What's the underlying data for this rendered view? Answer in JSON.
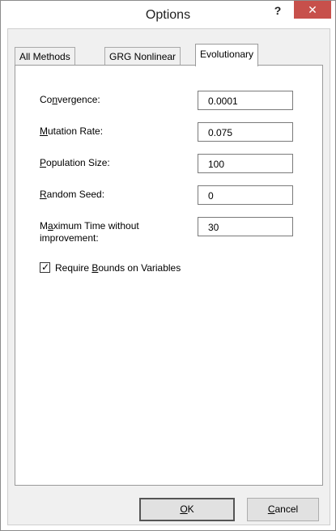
{
  "window": {
    "title": "Options",
    "help_label": "?",
    "close_label": "✕"
  },
  "tabs": [
    {
      "label": "All Methods",
      "active": false
    },
    {
      "label": "GRG Nonlinear",
      "active": false
    },
    {
      "label": "Evolutionary",
      "active": true
    }
  ],
  "fields": {
    "convergence": {
      "label_pre": "Co",
      "label_u": "n",
      "label_post": "vergence:",
      "value": "0.0001"
    },
    "mutation_rate": {
      "label_pre": "",
      "label_u": "M",
      "label_post": "utation Rate:",
      "value": "0.075"
    },
    "population_size": {
      "label_pre": "",
      "label_u": "P",
      "label_post": "opulation Size:",
      "value": "100"
    },
    "random_seed": {
      "label_pre": "",
      "label_u": "R",
      "label_post": "andom Seed:",
      "value": "0"
    },
    "max_time": {
      "label_pre": "M",
      "label_u": "a",
      "label_post": "ximum Time without",
      "label_line2": "improvement:",
      "value": "30"
    }
  },
  "require_bounds": {
    "checked": true,
    "label_pre": "Require ",
    "label_u": "B",
    "label_post": "ounds on Variables"
  },
  "buttons": {
    "ok": {
      "label_u": "O",
      "label_post": "K"
    },
    "cancel": {
      "label_u": "C",
      "label_post": "ancel"
    }
  }
}
